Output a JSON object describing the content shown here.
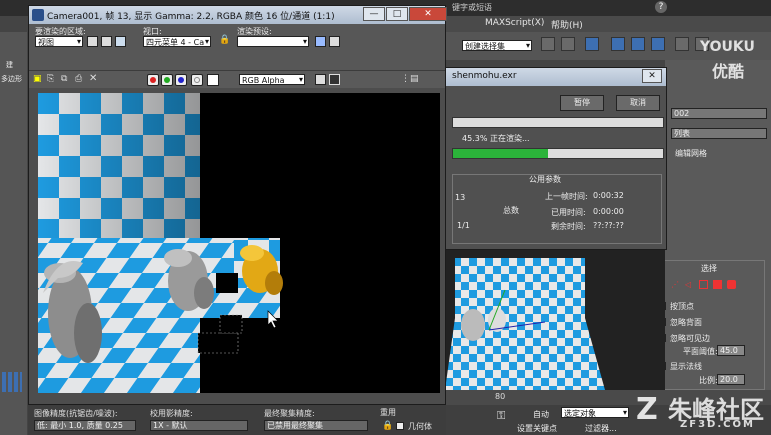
{
  "render_window": {
    "title": "Camera001, 帧 13, 显示 Gamma: 2.2, RGBA 颜色 16 位/通道 (1:1)",
    "area_label": "要渲染的区域:",
    "area_value": "视图",
    "viewport_label": "视口:",
    "viewport_value": "四元菜单 4 - Ca",
    "preset_label": "渲染预设:",
    "channel_value": "RGB Alpha",
    "minimize": "—",
    "restore": "□",
    "close": "✕"
  },
  "render_bottom": {
    "image_precision_label": "图像精度(抗锯齿/噪波):",
    "image_precision_value": "低: 最小 1.0, 质量 0.25",
    "gi_label": "校用影精度:",
    "gi_value": "1X - 默认",
    "final_gather_label": "最终聚集精度:",
    "final_gather_value": "已禁用最终聚集",
    "reuse_label": "重用",
    "geometry_label": "几何体"
  },
  "progress_dialog": {
    "title": "shenmohu.exr",
    "pause_label": "暂停",
    "cancel_label": "取消",
    "status_text": "45.3% 正在渲染...",
    "progress_percent": 45.3,
    "params_title": "公用参数",
    "total_label": "总数",
    "value_13": "13",
    "value_1_1": "1/1",
    "last_frame_label": "上一帧时间:",
    "last_frame_value": "0:00:32",
    "elapsed_label": "已用时间:",
    "elapsed_value": "0:00:00",
    "remaining_label": "剩余时间:",
    "remaining_value": "??:??:??"
  },
  "max_ui": {
    "menu_right_text": "键字或短语",
    "menu_maxscript": "MAXScript(X)",
    "menu_help": "帮助(H)",
    "selection_set": "创建选择集",
    "panel_value": "002",
    "panel_list": "列表",
    "panel_mesh": "编辑网格",
    "select_title": "选择",
    "vertex_label": "按顶点",
    "ignore_back_label": "忽略背面",
    "ignore_visible_label": "忽略可见边",
    "plane_threshold_label": "平面阈值:",
    "plane_threshold_value": "45.0",
    "show_normals_label": "显示法线",
    "scale_label": "比例:",
    "scale_value": "20.0",
    "timeline_value": "80",
    "auto_key_label": "自动",
    "select_obj_label": "选定对象",
    "set_key_label": "设置关键点",
    "filter_label": "过滤器...",
    "left_label_1": "多边形",
    "left_label_2": "建"
  },
  "watermarks": {
    "youku_en": "YOUKU",
    "youku_cn": "优酷",
    "site_cn": "朱峰社区",
    "site_url": "ZF3D.COM"
  },
  "colors": {
    "checker_blue": "#1e9be0",
    "checker_white": "#e8e8e8",
    "progress_green": "#2bb33a",
    "title_blue": "#2a4f8a"
  }
}
